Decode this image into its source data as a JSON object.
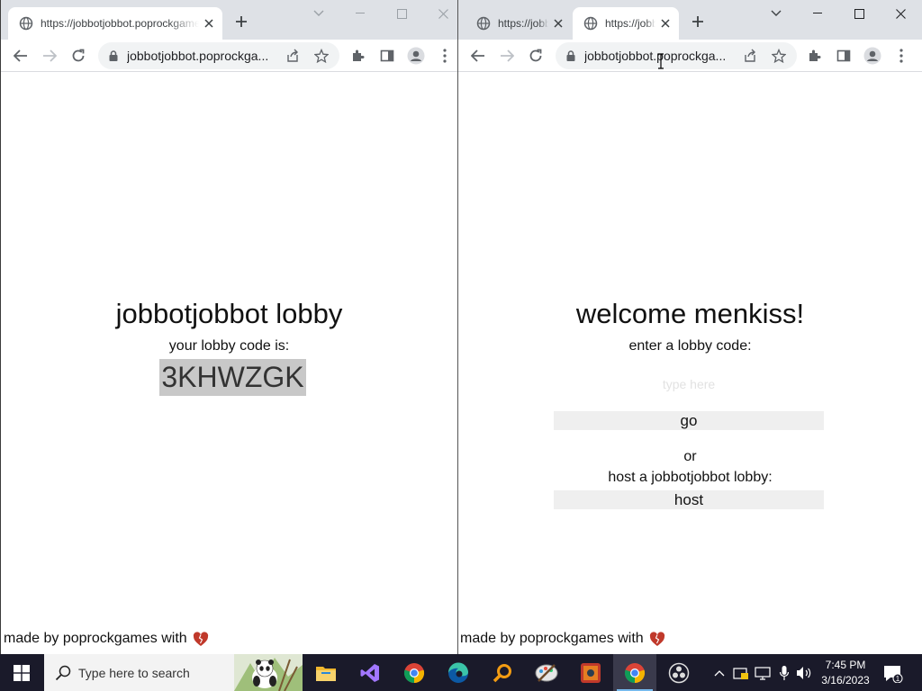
{
  "left_window": {
    "tab_title": "https://jobbotjobbot.poprockgames",
    "url": "jobbotjobbot.poprockga...",
    "heading": "jobbotjobbot lobby",
    "subheading": "your lobby code is:",
    "lobby_code": "3KHWZGK",
    "footer": "made by poprockgames with"
  },
  "right_window": {
    "tabs": [
      {
        "title": "https://jobbotjobbot",
        "active": false
      },
      {
        "title": "https://jobbotjobbot",
        "active": true
      }
    ],
    "url": "jobbotjobbot.poprockga...",
    "heading": "welcome menkiss!",
    "enter_label": "enter a lobby code:",
    "code_placeholder": "type here",
    "go_label": "go",
    "or_label": "or",
    "host_prompt": "host a jobbotjobbot lobby:",
    "host_label": "host",
    "footer": "made by poprockgames with"
  },
  "taskbar": {
    "search_placeholder": "Type here to search",
    "time": "7:45 PM",
    "date": "3/16/2023",
    "notification_count": "1",
    "pinned_apps": [
      "file-explorer",
      "visual-studio",
      "chrome",
      "edge",
      "search-tool",
      "paint-app",
      "game-app",
      "chrome-active",
      "obs"
    ]
  },
  "colors": {
    "tabstrip": "#dee1e6",
    "code_highlight": "#c8c8c8",
    "button_bg": "#efefef",
    "taskbar": "#1a1a2a",
    "heart": "#c0392b"
  }
}
